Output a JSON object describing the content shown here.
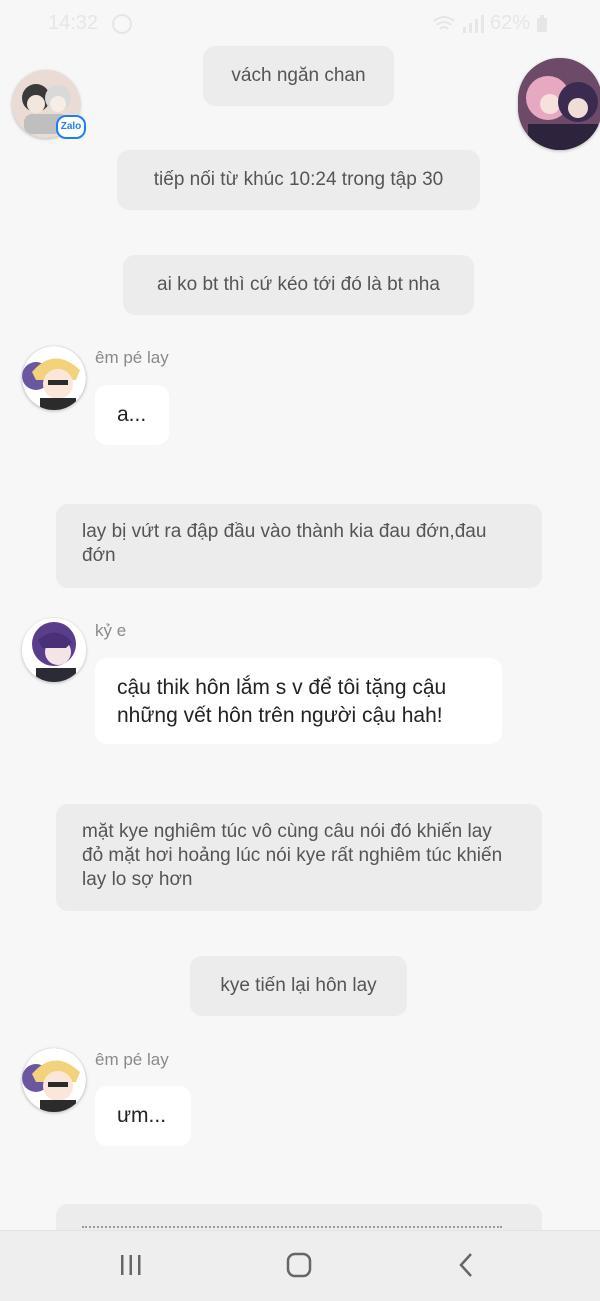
{
  "status_bar": {
    "time": "14:32",
    "battery": "62%"
  },
  "group": {
    "avatar_badge": "Zalo"
  },
  "messages": [
    {
      "type": "system",
      "text": "vách ngăn chan"
    },
    {
      "type": "system",
      "text": "tiếp nối từ khúc 10:24 trong tập 30"
    },
    {
      "type": "system",
      "text": "ai ko bt thì cứ kéo tới đó là bt nha"
    },
    {
      "type": "message",
      "sender": "êm pé lay",
      "text": "a..."
    },
    {
      "type": "narration",
      "text": "lay bị vứt ra đập đầu vào thành kia đau đớn,đau đớn"
    },
    {
      "type": "message",
      "sender": "kỷ e",
      "text": "cậu thik hôn lắm s v để tôi tặng cậu những vết hôn trên người cậu hah!"
    },
    {
      "type": "narration",
      "text": "mặt kye nghiêm túc vô cùng câu nói đó khiến lay đỏ mặt hơi hoảng lúc nói kye rất nghiêm túc khiến lay lo sợ hơn"
    },
    {
      "type": "system",
      "text": "kye tiến lại hôn lay"
    },
    {
      "type": "message",
      "sender": "êm pé lay",
      "text": "ưm..."
    }
  ],
  "colors": {
    "background": "#f7f7f7",
    "system_bubble": "#ececec",
    "message_bubble": "#ffffff",
    "sender_name": "#8a8a8a"
  },
  "icons": {
    "nav_recent": "recent-apps-icon",
    "nav_home": "home-icon",
    "nav_back": "back-icon"
  }
}
